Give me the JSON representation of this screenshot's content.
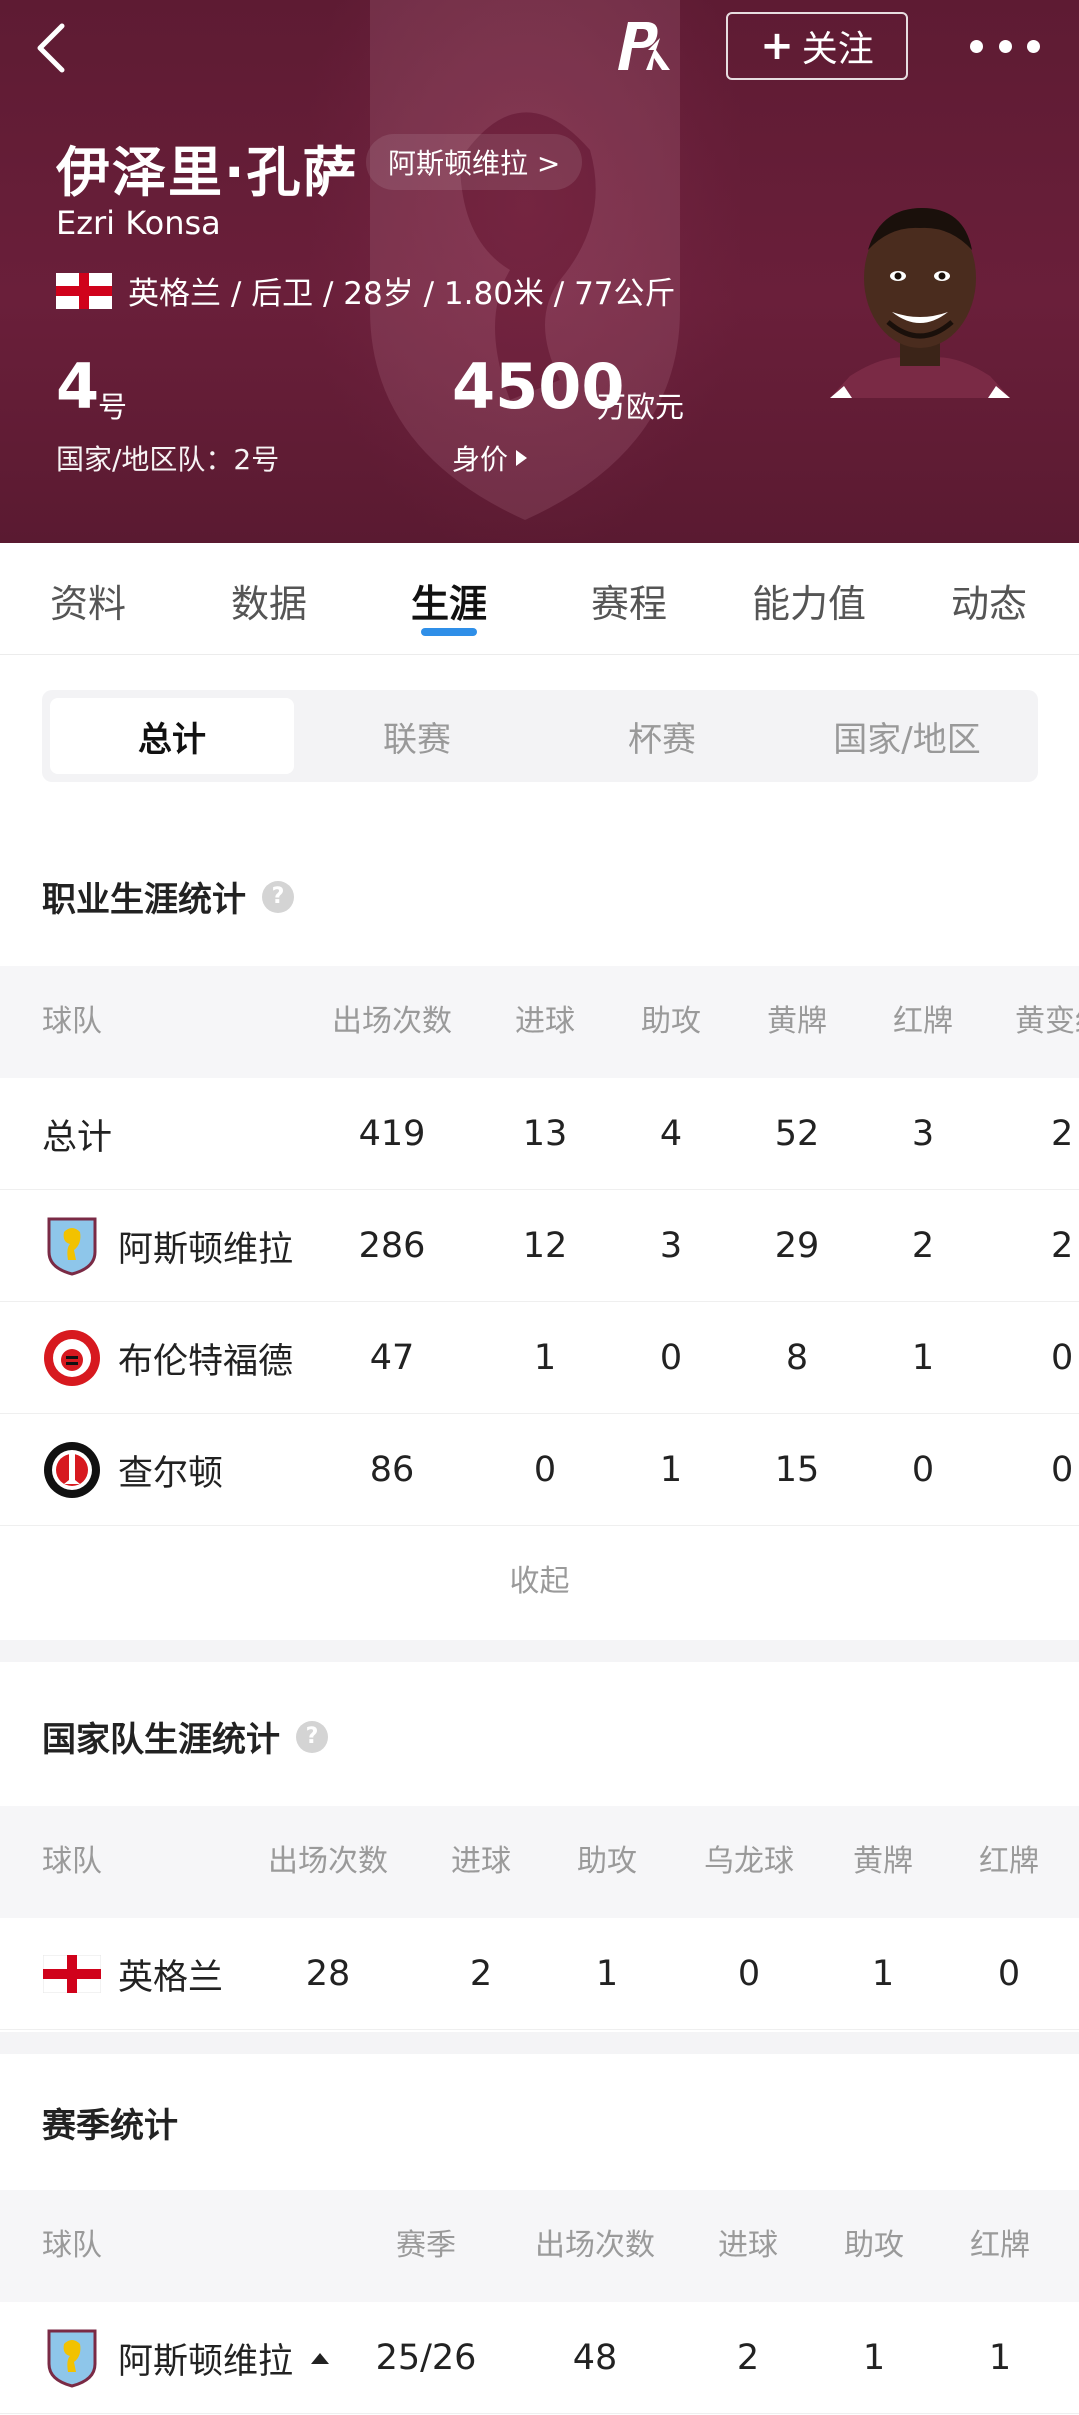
{
  "header": {
    "back_icon": "chevron-left-icon",
    "brand_logo": "PK",
    "follow_label": "关注",
    "more_icon": "more-dots-icon",
    "name_cn": "伊泽里·孔萨",
    "club_link": "阿斯顿维拉 >",
    "name_en": "Ezri Konsa",
    "info_line": "英格兰 / 后卫 / 28岁 / 1.80米 / 77公斤",
    "shirt_number": "4",
    "shirt_unit": "号",
    "national_number": "国家/地区队：2号",
    "market_value": "4500",
    "market_value_unit": "万欧元",
    "market_value_label": "身价",
    "colors": {
      "background": "#62203a",
      "accent": "#2f8fe8"
    }
  },
  "tabs": [
    {
      "label": "资料"
    },
    {
      "label": "数据"
    },
    {
      "label": "生涯",
      "active": true
    },
    {
      "label": "赛程"
    },
    {
      "label": "能力值"
    },
    {
      "label": "动态"
    }
  ],
  "segments": [
    {
      "label": "总计",
      "active": true
    },
    {
      "label": "联赛"
    },
    {
      "label": "杯赛"
    },
    {
      "label": "国家/地区"
    }
  ],
  "career": {
    "title": "职业生涯统计",
    "columns": [
      "球队",
      "出场次数",
      "进球",
      "助攻",
      "黄牌",
      "红牌",
      "黄变红"
    ],
    "rows": [
      {
        "team": "总计",
        "apps": "419",
        "goals": "13",
        "assists": "4",
        "yellow": "52",
        "red": "3",
        "yr": "2"
      },
      {
        "team": "阿斯顿维拉",
        "badge": "aston-villa-badge",
        "apps": "286",
        "goals": "12",
        "assists": "3",
        "yellow": "29",
        "red": "2",
        "yr": "2"
      },
      {
        "team": "布伦特福德",
        "badge": "brentford-badge",
        "apps": "47",
        "goals": "1",
        "assists": "0",
        "yellow": "8",
        "red": "1",
        "yr": "0"
      },
      {
        "team": "查尔顿",
        "badge": "charlton-badge",
        "apps": "86",
        "goals": "0",
        "assists": "1",
        "yellow": "15",
        "red": "0",
        "yr": "0"
      }
    ],
    "collapse_label": "收起"
  },
  "national": {
    "title": "国家队生涯统计",
    "columns": [
      "球队",
      "出场次数",
      "进球",
      "助攻",
      "乌龙球",
      "黄牌",
      "红牌"
    ],
    "rows": [
      {
        "team": "英格兰",
        "apps": "28",
        "goals": "2",
        "assists": "1",
        "own_goals": "0",
        "yellow": "1",
        "red": "0"
      }
    ]
  },
  "season": {
    "title": "赛季统计",
    "columns": [
      "球队",
      "赛季",
      "出场次数",
      "进球",
      "助攻",
      "红牌"
    ],
    "rows": [
      {
        "team": "阿斯顿维拉",
        "season": "25/26",
        "apps": "48",
        "goals": "2",
        "assists": "1",
        "red": "1"
      }
    ]
  }
}
